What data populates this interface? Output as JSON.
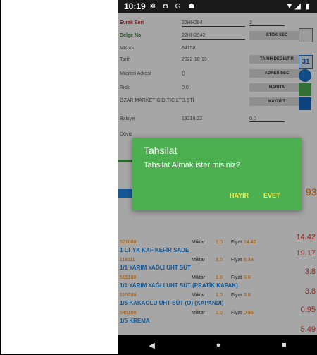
{
  "status_bar": {
    "time": "10:19",
    "left_icons": "✲ ◘ G ☗",
    "right_icons": "▼◢ ▮"
  },
  "form": {
    "evrak_seri": {
      "label": "Evrak Seri",
      "value": "22HH294",
      "side_value": "2"
    },
    "belge_no": {
      "label": "Belge No",
      "value": "22HH2942"
    },
    "stok_sec_button": "STOK SEC",
    "mkodu": {
      "label": "MKodu",
      "value": "64158"
    },
    "tarih": {
      "label": "Tarih",
      "value": "2022-10-13"
    },
    "tarih_degistir_button": "TARIH DEĞİSTIR",
    "calendar_day": "31",
    "musteri_adresi": {
      "label": "Müşteri Adresi",
      "value": "0"
    },
    "adres_sec_button": "ADRES SEC",
    "risk": {
      "label": "Risk",
      "value": "0.0"
    },
    "harita_button": "HARITA",
    "customer_name": "OZAR MARKET GID.TİC.LTD.ŞTİ",
    "kaydet_button": "KAYDET",
    "bakiye": {
      "label": "Bakiye",
      "value": "13219.22",
      "side_value": "0.0"
    },
    "doviz": {
      "label": "Döviz"
    },
    "big_number": "93"
  },
  "products": [
    {
      "code": "521000",
      "name": "",
      "miktar_label": "Miktar",
      "miktar": "1.0",
      "fiyat_label": "Fiyat",
      "fiyat": "14.42",
      "total": "14.42"
    },
    {
      "code": "118111",
      "name": "1 LT YK KAF KEFİR SADE",
      "miktar_label": "Miktar",
      "miktar": "3.0",
      "fiyat_label": "Fiyat",
      "fiyat": "6.39",
      "total": "19.17"
    },
    {
      "code": "515100",
      "name": "1/1 YARIM YAĞLI UHT SÜT",
      "miktar_label": "Miktar",
      "miktar": "1.0",
      "fiyat_label": "Fiyat",
      "fiyat": "3.8",
      "total": "3.8"
    },
    {
      "code": "515200",
      "name": "1/1 YARIM YAĞLI UHT SÜT (PRATİK KAPAK)",
      "miktar_label": "Miktar",
      "miktar": "1.0",
      "fiyat_label": "Fiyat",
      "fiyat": "3.8",
      "total": "3.8"
    },
    {
      "code": "545100",
      "name": "1/5 KAKAOLU UHT SÜT (O) (KAPANDI)",
      "miktar_label": "Miktar",
      "miktar": "1.0",
      "fiyat_label": "Fiyat",
      "fiyat": "0.95",
      "total": "0.95"
    },
    {
      "code": "",
      "name": "1/5 KREMA",
      "miktar_label": "",
      "miktar": "",
      "fiyat_label": "",
      "fiyat": "",
      "total": "5.49"
    }
  ],
  "dialog": {
    "title": "Tahsilat",
    "message": "Tahsilat Almak ister misiniz?",
    "no_button": "HAYIR",
    "yes_button": "EVET"
  },
  "navbar": {
    "back": "◀",
    "home": "●",
    "recents": "■"
  },
  "colors": {
    "dialog_bg": "#4caf50",
    "dialog_button": "#ffeb3b",
    "accent_orange": "#f57c00",
    "product_blue": "#1e88e5",
    "total_red": "#e53935"
  }
}
